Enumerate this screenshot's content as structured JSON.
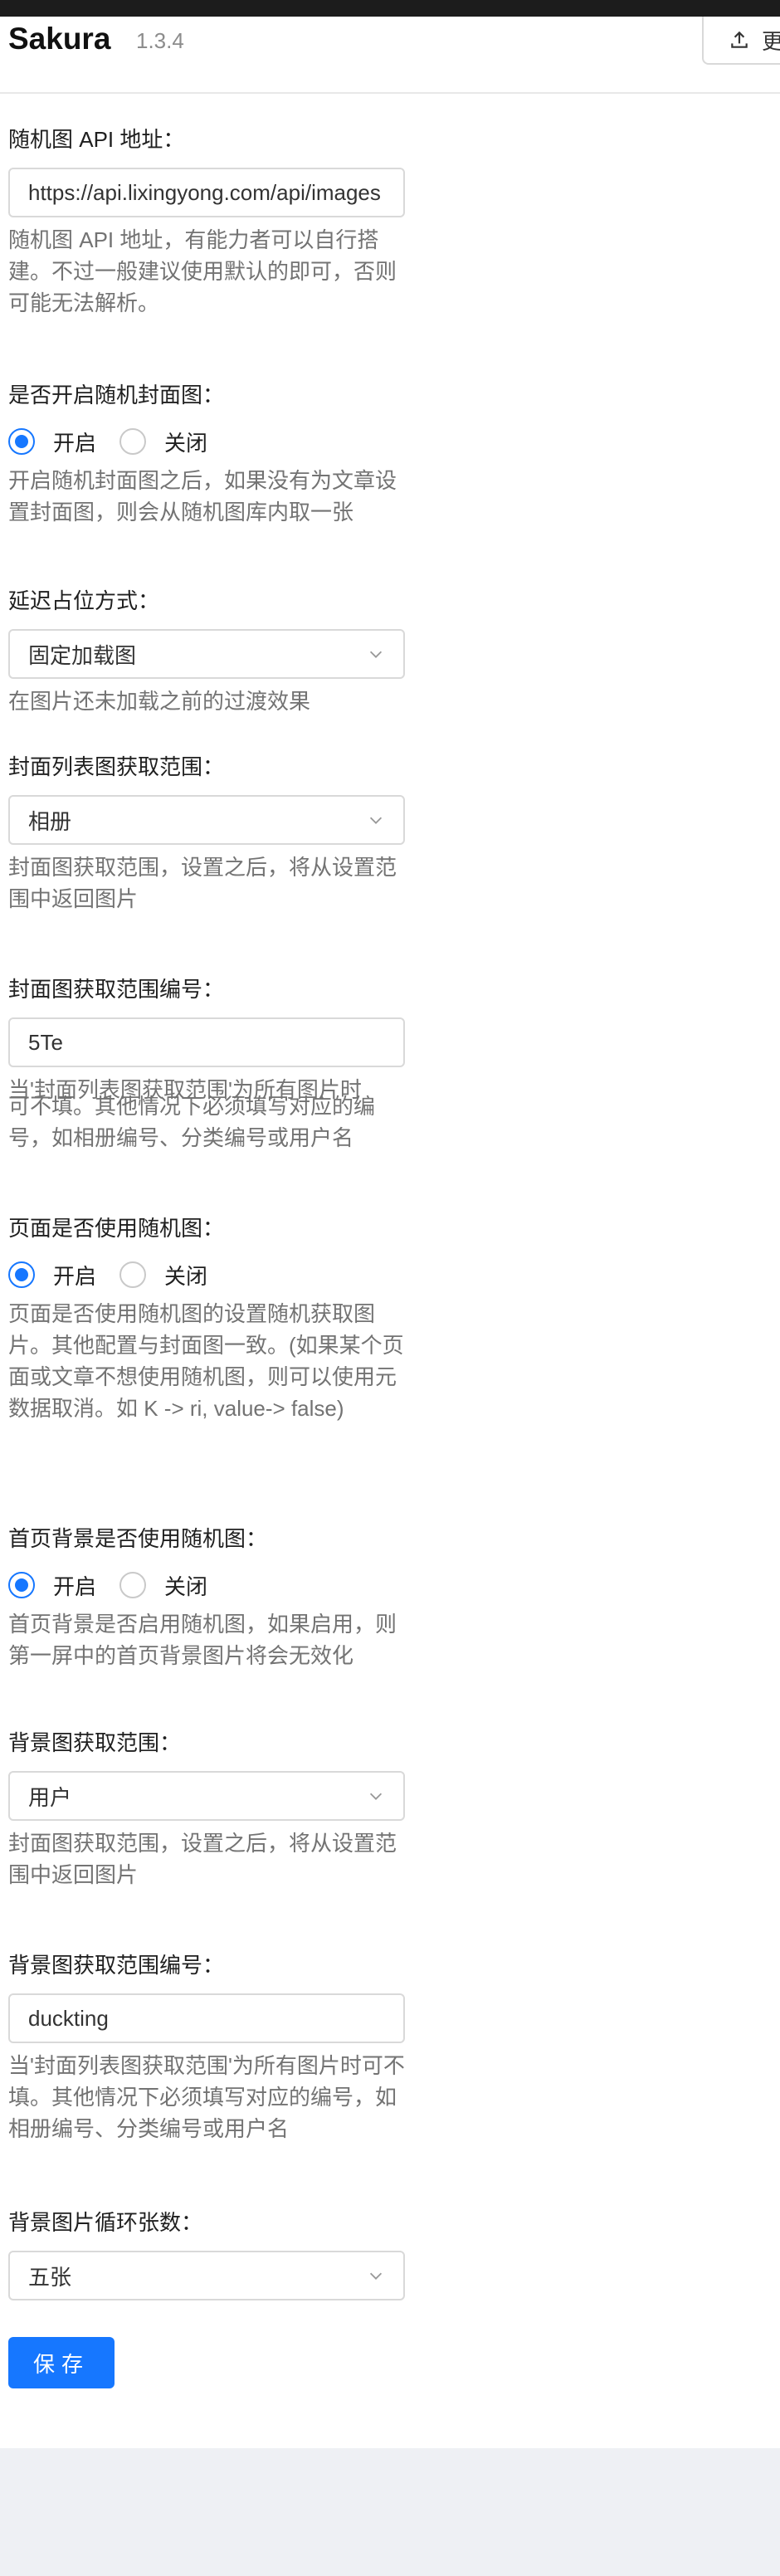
{
  "header": {
    "title": "Sakura",
    "version": "1.3.4",
    "upload_label": "更"
  },
  "fields": {
    "random_api": {
      "label": "随机图 API 地址：",
      "value": "https://api.lixingyong.com/api/images",
      "help": "随机图 API 地址，有能力者可以自行搭建。不过一般建议使用默认的即可，否则可能无法解析。"
    },
    "random_cover": {
      "label": "是否开启随机封面图：",
      "options": [
        "开启",
        "关闭"
      ],
      "selected": "开启",
      "help": "开启随机封面图之后，如果没有为文章设置封面图，则会从随机图库内取一张"
    },
    "lazy_placeholder": {
      "label": "延迟占位方式：",
      "value": "固定加载图",
      "help": "在图片还未加载之前的过渡效果"
    },
    "cover_range": {
      "label": "封面列表图获取范围：",
      "value": "相册",
      "help": "封面图获取范围，设置之后，将从设置范围中返回图片"
    },
    "cover_range_id": {
      "label": "封面图获取范围编号：",
      "value": "5Te",
      "help_line1": "当'封面列表图获取范围'为所有图片时",
      "help_line2": "可不填。其他情况下必须填写对应的编",
      "help_line3": "号，如相册编号、分类编号或用户名"
    },
    "page_random": {
      "label": "页面是否使用随机图：",
      "options": [
        "开启",
        "关闭"
      ],
      "selected": "开启",
      "help": "页面是否使用随机图的设置随机获取图片。其他配置与封面图一致。(如果某个页面或文章不想使用随机图，则可以使用元数据取消。如 K -> ri, value-> false)"
    },
    "home_bg_random": {
      "label": "首页背景是否使用随机图：",
      "options": [
        "开启",
        "关闭"
      ],
      "selected": "开启",
      "help": "首页背景是否启用随机图，如果启用，则第一屏中的首页背景图片将会无效化"
    },
    "bg_range": {
      "label": "背景图获取范围：",
      "value": "用户",
      "help": "封面图获取范围，设置之后，将从设置范围中返回图片"
    },
    "bg_range_id": {
      "label": "背景图获取范围编号：",
      "value": "duckting",
      "help": "当'封面列表图获取范围'为所有图片时可不填。其他情况下必须填写对应的编号，如相册编号、分类编号或用户名"
    },
    "bg_loop_count": {
      "label": "背景图片循环张数：",
      "value": "五张"
    }
  },
  "save_label": "保存"
}
